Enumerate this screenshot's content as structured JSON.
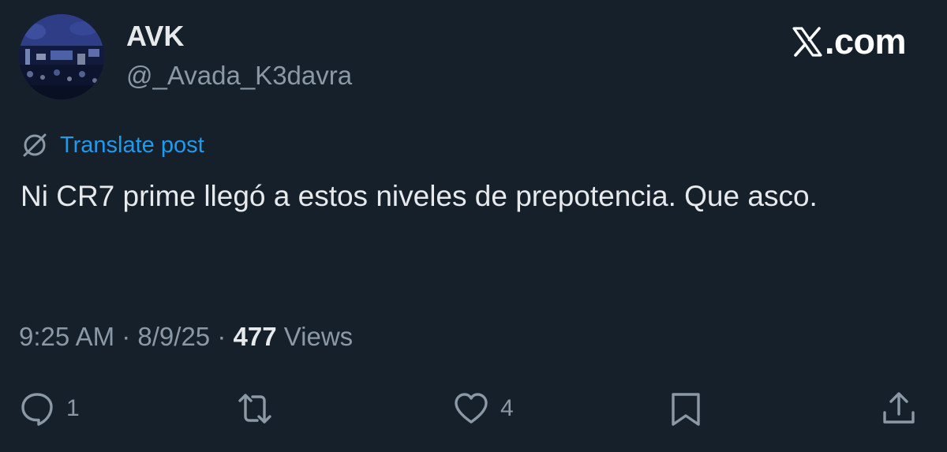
{
  "author": {
    "display_name": "AVK",
    "handle": "@_Avada_K3davra",
    "avatar_icon": "crowd-photo-avatar"
  },
  "brand": {
    "logo_icon": "x-logo-icon",
    "suffix": ".com"
  },
  "translate": {
    "icon": "globe-slash-icon",
    "label": "Translate post"
  },
  "post": {
    "text": "Ni CR7 prime llegó a estos niveles de prepotencia. Que asco."
  },
  "meta": {
    "time": "9:25 AM",
    "sep1": " · ",
    "date": "8/9/25",
    "sep2": " · ",
    "views_count": "477",
    "views_label": " Views"
  },
  "actions": {
    "reply": {
      "icon": "reply-icon",
      "count": "1"
    },
    "repost": {
      "icon": "repost-icon",
      "count": ""
    },
    "like": {
      "icon": "heart-icon",
      "count": "4"
    },
    "bookmark": {
      "icon": "bookmark-icon",
      "count": ""
    },
    "share": {
      "icon": "share-icon",
      "count": ""
    }
  },
  "colors": {
    "background": "#15202b",
    "text": "#e7e9ea",
    "muted": "#8b98a5",
    "link": "#1d9bf0"
  }
}
